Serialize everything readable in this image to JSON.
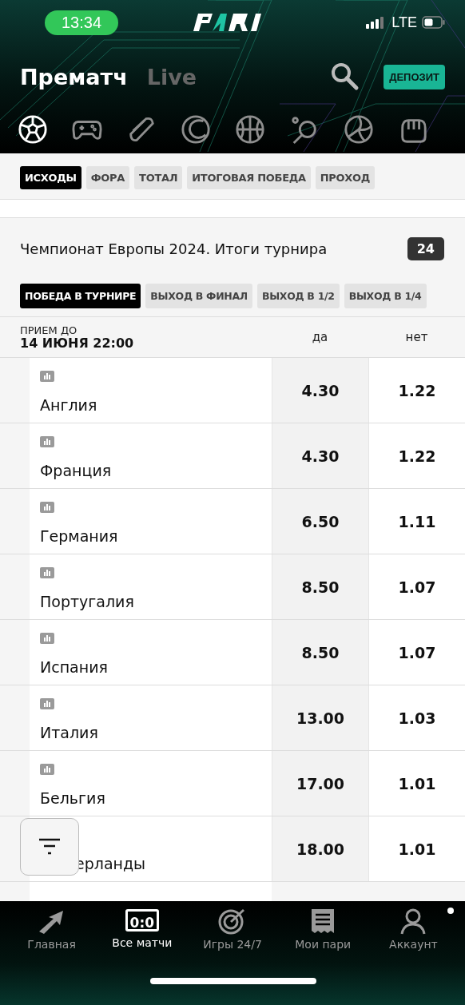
{
  "status_bar": {
    "time": "13:34",
    "network": "LTE"
  },
  "header": {
    "tabs": [
      {
        "label": "Прематч",
        "selected": true
      },
      {
        "label": "Live",
        "selected": false
      }
    ],
    "deposit": "ДЕПОЗИТ"
  },
  "sports": [
    {
      "kind": "soccer",
      "selected": true
    },
    {
      "kind": "gamepad",
      "selected": false
    },
    {
      "kind": "puck",
      "selected": false
    },
    {
      "kind": "tennis",
      "selected": false
    },
    {
      "kind": "basketball",
      "selected": false
    },
    {
      "kind": "pingpong",
      "selected": false
    },
    {
      "kind": "volleyball",
      "selected": false
    },
    {
      "kind": "boxing",
      "selected": false
    }
  ],
  "market_filters": [
    {
      "label": "ИСХОДЫ",
      "selected": true
    },
    {
      "label": "ФОРА",
      "selected": false
    },
    {
      "label": "ТОТАЛ",
      "selected": false
    },
    {
      "label": "ИТОГОВАЯ ПОБЕДА",
      "selected": false
    },
    {
      "label": "ПРОХОД",
      "selected": false
    }
  ],
  "tournament": {
    "title": "Чемпионат Европы 2024. Итоги турнира",
    "count": "24",
    "markets": [
      {
        "label": "ПОБЕДА В ТУРНИРЕ",
        "selected": true
      },
      {
        "label": "ВЫХОД В ФИНАЛ",
        "selected": false
      },
      {
        "label": "ВЫХОД В 1/2",
        "selected": false
      },
      {
        "label": "ВЫХОД В 1/4",
        "selected": false
      }
    ],
    "deadline_label": "ПРИЕМ ДО",
    "deadline": "14 ИЮНЯ 22:00",
    "columns": [
      "да",
      "нет"
    ],
    "rows": [
      {
        "name": "Англия",
        "yes": "4.30",
        "no": "1.22"
      },
      {
        "name": "Франция",
        "yes": "4.30",
        "no": "1.22"
      },
      {
        "name": "Германия",
        "yes": "6.50",
        "no": "1.11"
      },
      {
        "name": "Португалия",
        "yes": "8.50",
        "no": "1.07"
      },
      {
        "name": "Испания",
        "yes": "8.50",
        "no": "1.07"
      },
      {
        "name": "Италия",
        "yes": "13.00",
        "no": "1.03"
      },
      {
        "name": "Бельгия",
        "yes": "17.00",
        "no": "1.01"
      },
      {
        "name": "ерланды",
        "yes": "18.00",
        "no": "1.01",
        "partly_hidden": true
      }
    ]
  },
  "bottom_nav": [
    {
      "kind": "home",
      "label": "Главная",
      "selected": false
    },
    {
      "kind": "score",
      "label": "Все матчи",
      "icon_text": "0:0",
      "selected": true
    },
    {
      "kind": "target",
      "label": "Игры 24/7",
      "selected": false
    },
    {
      "kind": "receipt",
      "label": "Мои пари",
      "selected": false
    },
    {
      "kind": "user",
      "label": "Аккаунт",
      "selected": false
    }
  ]
}
